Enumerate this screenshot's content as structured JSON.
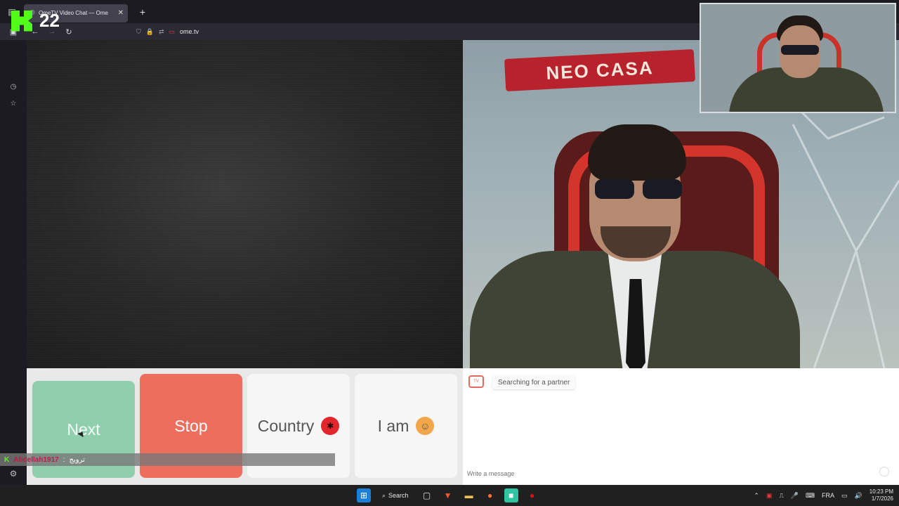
{
  "browser": {
    "tab_title": "OmeTV Video Chat — Ome",
    "tab_close": "✕",
    "new_tab": "+",
    "url": "ome.tv"
  },
  "overlay": {
    "kick_viewers": "22",
    "chat_user": "Abdellah1917",
    "chat_separator": ":",
    "chat_message": "ترويج",
    "brand_color": "#53fc18"
  },
  "controls": {
    "next_label": "Next",
    "stop_label": "Stop",
    "country_label": "Country",
    "iam_label": "I am",
    "next_color": "#8fcfae",
    "stop_color": "#eb6f5c"
  },
  "chat": {
    "status": "Searching for a partner",
    "input_placeholder": "Write a message"
  },
  "self_video": {
    "banner_text": "NEO CASA"
  },
  "taskbar": {
    "search_label": "Search",
    "language": "FRA",
    "time": "10:23 PM",
    "date": "1/7/2026"
  }
}
